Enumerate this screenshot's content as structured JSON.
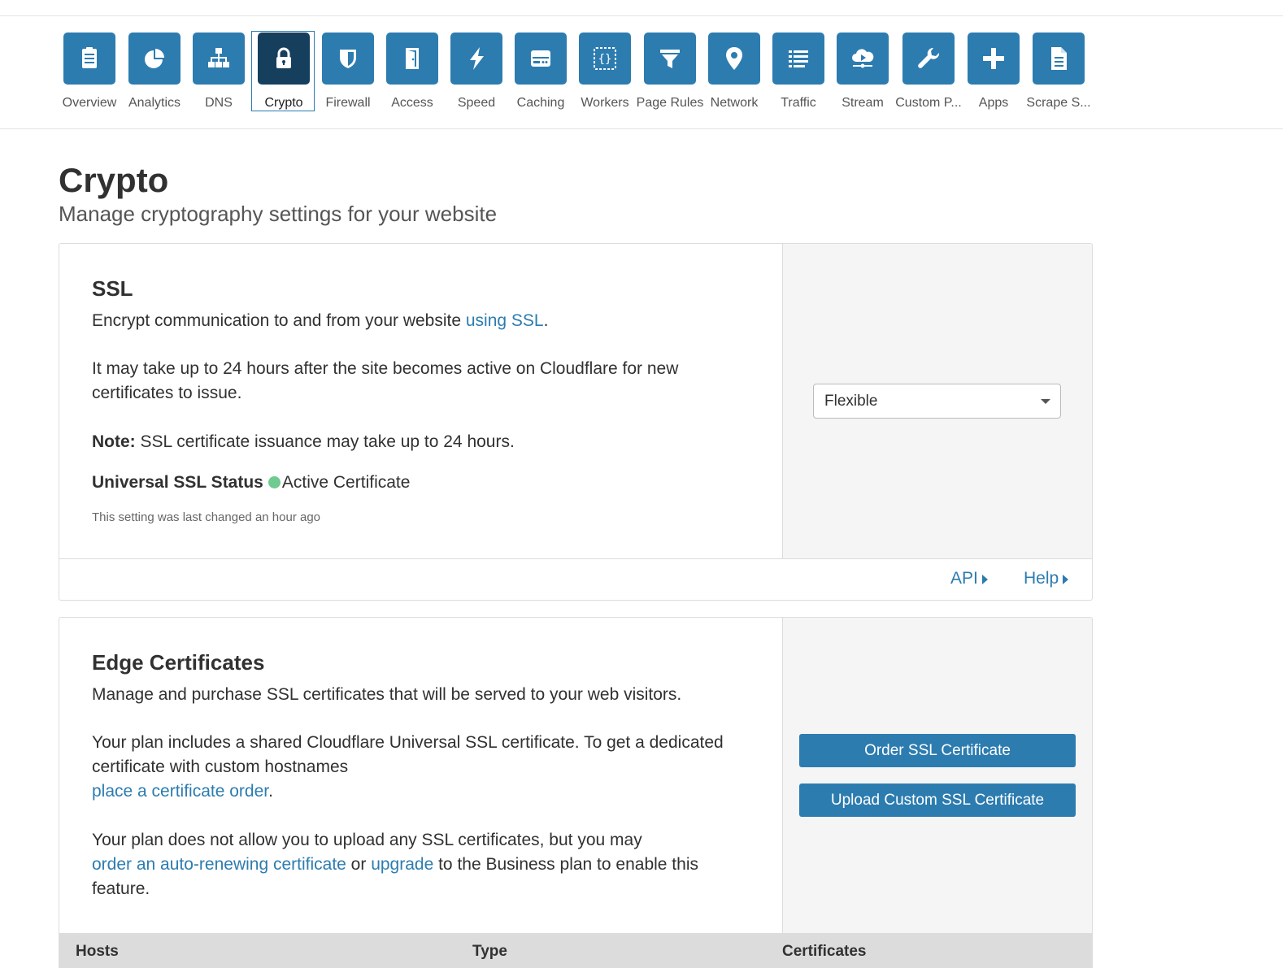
{
  "nav": {
    "items": [
      {
        "label": "Overview",
        "icon": "clipboard-icon",
        "active": false
      },
      {
        "label": "Analytics",
        "icon": "pie-chart-icon",
        "active": false
      },
      {
        "label": "DNS",
        "icon": "sitemap-icon",
        "active": false
      },
      {
        "label": "Crypto",
        "icon": "lock-icon",
        "active": true
      },
      {
        "label": "Firewall",
        "icon": "shield-icon",
        "active": false
      },
      {
        "label": "Access",
        "icon": "door-icon",
        "active": false
      },
      {
        "label": "Speed",
        "icon": "lightning-icon",
        "active": false
      },
      {
        "label": "Caching",
        "icon": "server-icon",
        "active": false
      },
      {
        "label": "Workers",
        "icon": "code-braces-icon",
        "active": false
      },
      {
        "label": "Page Rules",
        "icon": "filter-icon",
        "active": false
      },
      {
        "label": "Network",
        "icon": "map-pin-icon",
        "active": false
      },
      {
        "label": "Traffic",
        "icon": "list-icon",
        "active": false
      },
      {
        "label": "Stream",
        "icon": "cloud-stream-icon",
        "active": false
      },
      {
        "label": "Custom P...",
        "icon": "wrench-icon",
        "active": false
      },
      {
        "label": "Apps",
        "icon": "plus-icon",
        "active": false
      },
      {
        "label": "Scrape S...",
        "icon": "document-icon",
        "active": false
      }
    ],
    "tile_color": "#2c7cb0",
    "active_tile_color": "#163f5e"
  },
  "page": {
    "title": "Crypto",
    "subtitle": "Manage cryptography settings for your website"
  },
  "ssl": {
    "title": "SSL",
    "desc_text": "Encrypt communication to and from your website ",
    "desc_link": "using SSL",
    "desc_end": ".",
    "para2": "It may take up to 24 hours after the site becomes active on Cloudflare for new certificates to issue.",
    "note_label": "Note:",
    "note_text": " SSL certificate issuance may take up to 24 hours.",
    "status_label": "Universal SSL Status",
    "status_value": "Active Certificate",
    "status_color": "#6fcb91",
    "last_changed": "This setting was last changed an hour ago",
    "mode_selected": "Flexible",
    "api_link": "API",
    "help_link": "Help"
  },
  "edge": {
    "title": "Edge Certificates",
    "desc": "Manage and purchase SSL certificates that will be served to your web visitors.",
    "para2_text": "Your plan includes a shared Cloudflare Universal SSL certificate. To get a dedicated certificate with custom hostnames",
    "para2_link": "place a certificate order",
    "para2_end": ".",
    "para3_text": "Your plan does not allow you to upload any SSL certificates, but you may",
    "para3_link1": "order an auto-renewing certificate",
    "para3_mid": " or ",
    "para3_link2": "upgrade",
    "para3_end": " to the Business plan to enable this feature.",
    "order_button": "Order SSL Certificate",
    "upload_button": "Upload Custom SSL Certificate",
    "table_headers": [
      "Hosts",
      "Type",
      "Certificates"
    ]
  }
}
